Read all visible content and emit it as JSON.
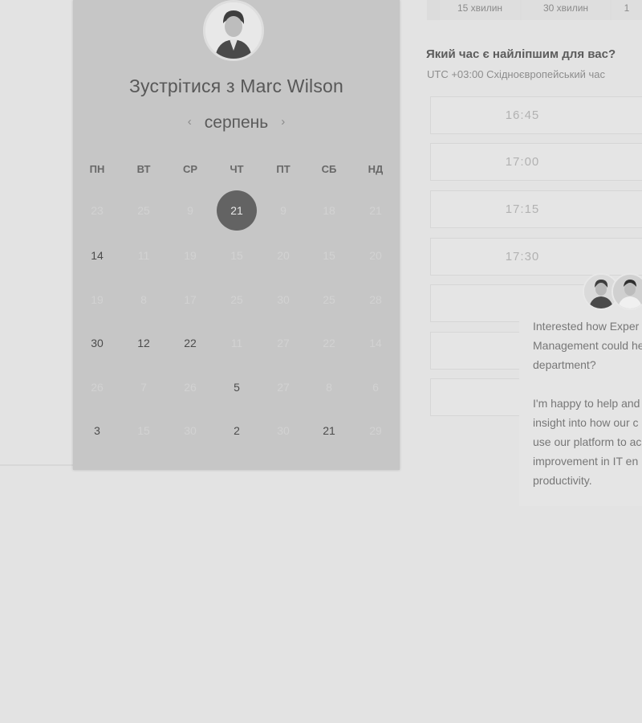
{
  "scheduler": {
    "title": "Зустрітися з Marc Wilson",
    "month": "серпень",
    "prev_icon": "chevron-left-icon",
    "next_icon": "chevron-right-icon",
    "weekdays": [
      "ПН",
      "ВТ",
      "СР",
      "ЧТ",
      "ПТ",
      "СБ",
      "НД"
    ],
    "weeks": [
      [
        {
          "d": "23",
          "available": false
        },
        {
          "d": "25",
          "available": false
        },
        {
          "d": "9",
          "available": false
        },
        {
          "d": "21",
          "available": true,
          "selected": true
        },
        {
          "d": "9",
          "available": false
        },
        {
          "d": "18",
          "available": false
        },
        {
          "d": "21",
          "available": false
        }
      ],
      [
        {
          "d": "14",
          "available": true
        },
        {
          "d": "11",
          "available": false
        },
        {
          "d": "19",
          "available": false
        },
        {
          "d": "15",
          "available": false
        },
        {
          "d": "20",
          "available": false
        },
        {
          "d": "15",
          "available": false
        },
        {
          "d": "20",
          "available": false
        }
      ],
      [
        {
          "d": "19",
          "available": false
        },
        {
          "d": "8",
          "available": false
        },
        {
          "d": "17",
          "available": false
        },
        {
          "d": "25",
          "available": false
        },
        {
          "d": "30",
          "available": false
        },
        {
          "d": "25",
          "available": false
        },
        {
          "d": "28",
          "available": false
        }
      ],
      [
        {
          "d": "30",
          "available": true
        },
        {
          "d": "12",
          "available": true
        },
        {
          "d": "22",
          "available": true
        },
        {
          "d": "11",
          "available": false
        },
        {
          "d": "27",
          "available": false
        },
        {
          "d": "22",
          "available": false
        },
        {
          "d": "14",
          "available": false
        }
      ],
      [
        {
          "d": "26",
          "available": false
        },
        {
          "d": "7",
          "available": false
        },
        {
          "d": "26",
          "available": false
        },
        {
          "d": "5",
          "available": true
        },
        {
          "d": "27",
          "available": false
        },
        {
          "d": "8",
          "available": false
        },
        {
          "d": "6",
          "available": false
        }
      ],
      [
        {
          "d": "3",
          "available": true
        },
        {
          "d": "15",
          "available": false
        },
        {
          "d": "30",
          "available": false
        },
        {
          "d": "2",
          "available": true
        },
        {
          "d": "30",
          "available": false
        },
        {
          "d": "21",
          "available": true
        },
        {
          "d": "29",
          "available": false
        }
      ]
    ]
  },
  "durations": [
    "15 хвилин",
    "30 хвилин",
    "1"
  ],
  "time_question": "Який час є найліпшим для вас?",
  "timezone_label": "UTC +03:00 Східноєвропейський час",
  "time_slots": [
    "16:45",
    "17:00",
    "17:15",
    "17:30",
    "",
    "",
    ""
  ],
  "chat": {
    "message": "Interested how Exper\nManagement could he\ndepartment?\n\nI'm happy to help and\ninsight into how our c\nuse our platform to ac\nimprovement in IT en\nproductivity."
  },
  "colors": {
    "card_bg": "#c6c6c6",
    "selected_day": "#636363",
    "page_bg": "#e3e3e3"
  }
}
